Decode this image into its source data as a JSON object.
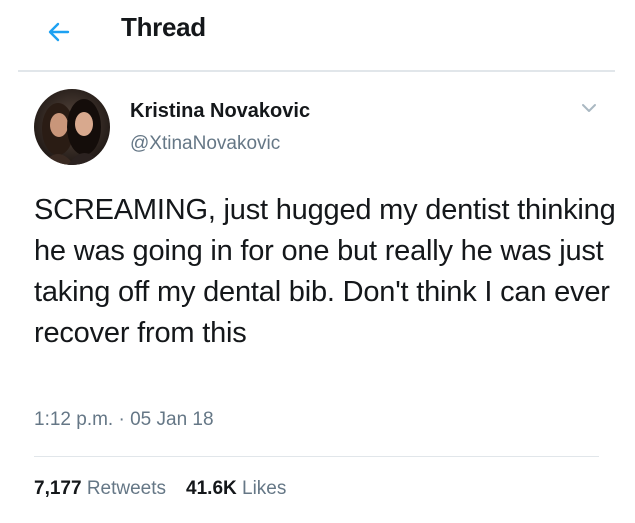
{
  "header": {
    "title": "Thread",
    "back_icon": "arrow-left-icon",
    "accent_color": "#1da1f2"
  },
  "tweet": {
    "author_name": "Kristina Novakovic",
    "author_handle": "@XtinaNovakovic",
    "text": "SCREAMING, just hugged my dentist thinking he was going in for one but really he was just taking off my dental bib. Don't think I can ever recover from this",
    "timestamp": "1:12 p.m. · 05 Jan 18",
    "menu_icon": "chevron-down-icon"
  },
  "stats": {
    "retweets_count": "7,177",
    "retweets_label": "Retweets",
    "likes_count": "41.6K",
    "likes_label": "Likes"
  }
}
